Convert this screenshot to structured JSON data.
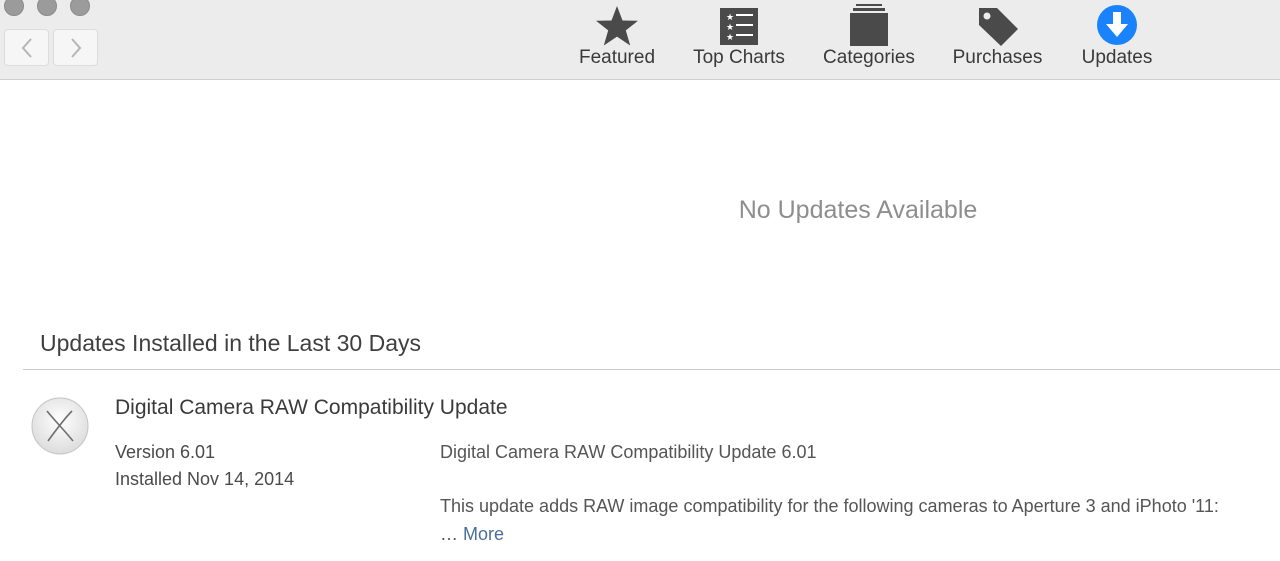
{
  "toolbar": {
    "items": [
      {
        "label": "Featured",
        "icon": "star-icon"
      },
      {
        "label": "Top Charts",
        "icon": "list-icon"
      },
      {
        "label": "Categories",
        "icon": "stack-icon"
      },
      {
        "label": "Purchases",
        "icon": "tag-icon"
      },
      {
        "label": "Updates",
        "icon": "download-icon"
      }
    ],
    "active_color": "#1a82fb",
    "icon_color": "#4a4a4a"
  },
  "main": {
    "empty_message": "No Updates Available",
    "section_title": "Updates Installed in the Last 30 Days",
    "installed": [
      {
        "name": "Digital Camera RAW Compatibility Update",
        "version": "Version 6.01",
        "installed_date": "Installed Nov 14, 2014",
        "description_title": "Digital Camera RAW Compatibility Update 6.01",
        "description": "This update adds RAW image compatibility for the following cameras to Aperture 3 and iPhoto '11:",
        "ellipsis": "…",
        "more_label": "More",
        "icon": "os-x-icon"
      }
    ]
  }
}
